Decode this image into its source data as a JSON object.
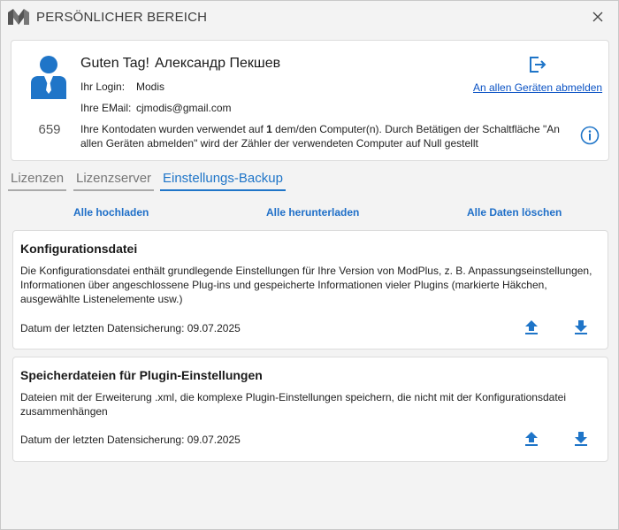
{
  "window": {
    "title": "PERSÖNLICHER BEREICH"
  },
  "user": {
    "greeting": "Guten Tag!",
    "name": "Александр Пекшев",
    "login_label": "Ihr Login:",
    "login_value": "Modis",
    "email_label": "Ihre EMail:",
    "email_value": "cjmodis@gmail.com",
    "computer_count": "659",
    "usage_text_before": "Ihre Kontodaten wurden verwendet auf ",
    "usage_count": "1",
    "usage_text_after": " dem/den Computer(n). Durch Betätigen der Schaltfläche \"An allen Geräten abmelden\" wird der Zähler der verwendeten Computer auf Null gestellt",
    "logout_all_label": "An allen Geräten abmelden"
  },
  "tabs": [
    {
      "label": "Lizenzen",
      "active": false
    },
    {
      "label": "Lizenzserver",
      "active": false
    },
    {
      "label": "Einstellungs-Backup",
      "active": true
    }
  ],
  "actions": {
    "upload_all": "Alle hochladen",
    "download_all": "Alle herunterladen",
    "delete_all": "Alle Daten löschen"
  },
  "sections": [
    {
      "title": "Konfigurationsdatei",
      "description": "Die Konfigurationsdatei enthält grundlegende Einstellungen für Ihre Version von ModPlus, z. B. Anpassungseinstellungen, Informationen über angeschlossene Plug-ins und gespeicherte Informationen vieler Plugins (markierte Häkchen, ausgewählte Listenelemente usw.)",
      "date_label": "Datum der letzten Datensicherung: 09.07.2025"
    },
    {
      "title": "Speicherdateien für Plugin-Einstellungen",
      "description": "Dateien mit der Erweiterung .xml, die komplexe Plugin-Einstellungen speichern, die nicht mit der Konfigurationsdatei zusammenhängen",
      "date_label": "Datum der letzten Datensicherung: 09.07.2025"
    }
  ],
  "colors": {
    "accent": "#1f75c8",
    "link": "#0a52c4",
    "background": "#f3f3f3",
    "card": "#ffffff"
  }
}
